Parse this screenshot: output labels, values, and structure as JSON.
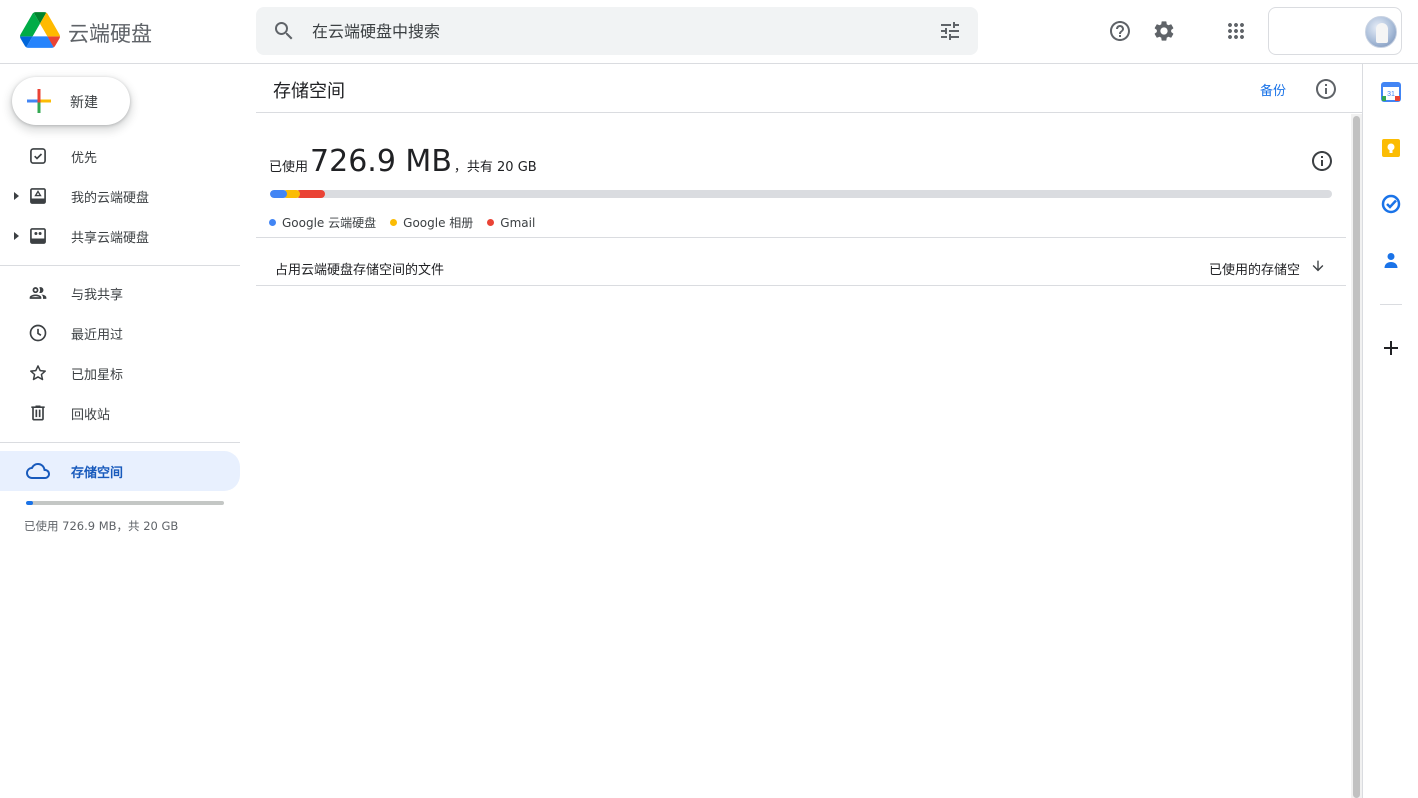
{
  "app": {
    "title": "云端硬盘"
  },
  "search": {
    "placeholder": "在云端硬盘中搜索"
  },
  "sidebar": {
    "new_label": "新建",
    "items": [
      {
        "label": "优先"
      },
      {
        "label": "我的云端硬盘"
      },
      {
        "label": "共享云端硬盘"
      },
      {
        "label": "与我共享"
      },
      {
        "label": "最近用过"
      },
      {
        "label": "已加星标"
      },
      {
        "label": "回收站"
      },
      {
        "label": "存储空间"
      }
    ],
    "usage_text": "已使用 726.9 MB，共 20 GB",
    "usage_fraction": 0.036
  },
  "main": {
    "title": "存储空间",
    "backup_label": "备份",
    "usage": {
      "prefix": "已使用",
      "amount": "726.9 MB",
      "suffix": "，共有 20 GB"
    },
    "bar_segments": [
      {
        "name": "Google 云端硬盘",
        "color": "#4285f4",
        "fraction": 0.016
      },
      {
        "name": "Google 相册",
        "color": "#fbbc04",
        "fraction": 0.012
      },
      {
        "name": "Gmail",
        "color": "#ea4335",
        "fraction": 0.024
      }
    ],
    "legend": [
      {
        "name": "Google 云端硬盘",
        "color": "#4285f4"
      },
      {
        "name": "Google 相册",
        "color": "#fbbc04"
      },
      {
        "name": "Gmail",
        "color": "#ea4335"
      }
    ],
    "files_label": "占用云端硬盘存储空间的文件",
    "sort_label": "已使用的存储空"
  }
}
